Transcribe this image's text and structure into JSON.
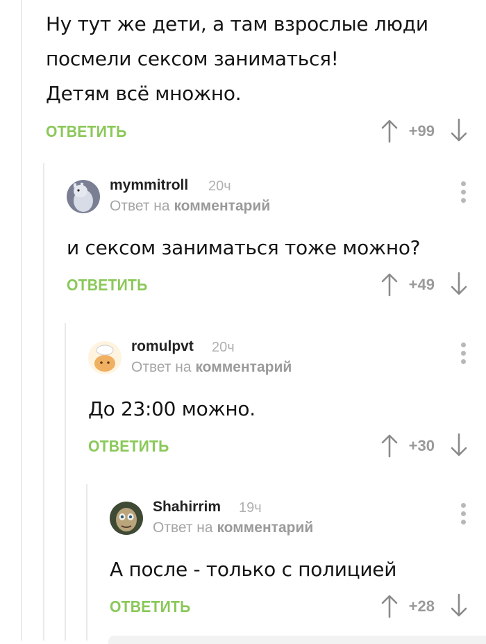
{
  "reply_label": "ОТВЕТИТЬ",
  "reply_to_prefix": "Ответ на",
  "reply_to_target": "комментарий",
  "accent_color": "#8ac858",
  "comments": [
    {
      "text": "Ну тут же дети, а там взрослые люди\nпосмели сексом заниматься!\nДетям всё множно.",
      "score": "+99"
    },
    {
      "author": "mymmitroll",
      "time": "20ч",
      "avatar_icon": "moomin-avatar-icon",
      "text": "и сексом заниматься тоже можно?",
      "score": "+49"
    },
    {
      "author": "romulpvt",
      "time": "20ч",
      "avatar_icon": "chef-avatar-icon",
      "text": "До 23:00 можно.",
      "score": "+30"
    },
    {
      "author": "Shahirrim",
      "time": "19ч",
      "avatar_icon": "gollum-avatar-icon",
      "text": "А после - только с полицией",
      "score": "+28"
    }
  ]
}
